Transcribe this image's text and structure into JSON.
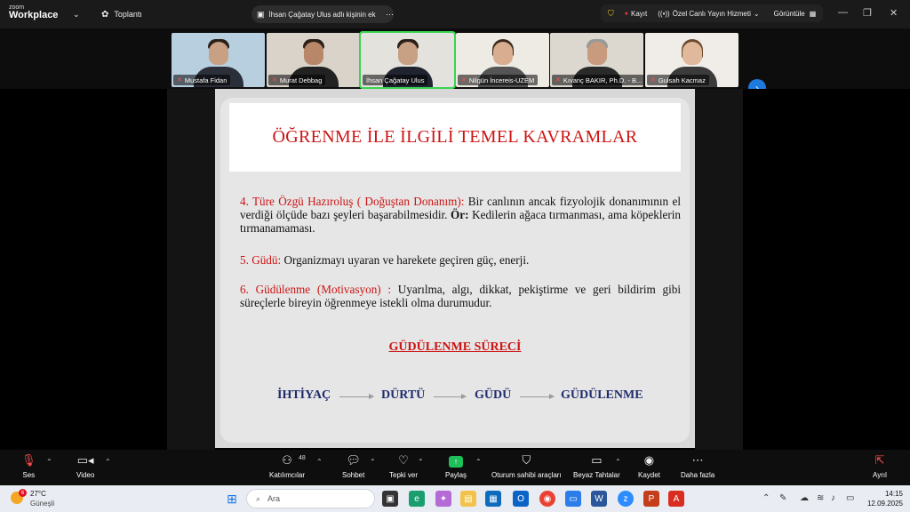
{
  "titlebar": {
    "logo_line1": "zoom",
    "logo_line2": "Workplace",
    "meeting_label": "Toplantı",
    "share_text": "İhsan Çağatay Ulus adlı kişinin ek",
    "record_label": "Kayıt",
    "live_label": "Özel Canlı Yayın Hizmeti",
    "view_label": "Görüntüle"
  },
  "participants": [
    {
      "name": "Mustafa Fidan"
    },
    {
      "name": "Murat Debbag"
    },
    {
      "name": "İhsan Çağatay Ulus"
    },
    {
      "name": "Nilgün İncereis-UZEM"
    },
    {
      "name": "Kıvanç BAKIR, Ph.D. - B..."
    },
    {
      "name": "Gulsah Kacmaz"
    }
  ],
  "slide": {
    "title": "ÖĞRENME İLE İLGİLİ TEMEL KAVRAMLAR",
    "p1_term": "4. Türe Özgü Hazıroluş ( Doğuştan Donanım):",
    "p1_text": " Bir canlının ancak fizyolojik donanımının el verdiği ölçüde bazı şeyleri başarabilmesidir. ",
    "p1_ex_label": "Ör:",
    "p1_ex_text": " Kedilerin ağaca tırmanması, ama köpeklerin tırmanamaması.",
    "p2_term": "5. Güdü:",
    "p2_text": " Organizmayı uyaran  ve harekete geçiren güç, enerji.",
    "p3_term": "6. Güdülenme (Motivasyon) :",
    "p3_text": " Uyarılma, algı, dikkat, pekiştirme ve geri bildirim gibi süreçlerle bireyin öğrenmeye istekli olma durumudur.",
    "process_title": "GÜDÜLENME SÜRECİ",
    "flow": [
      "İHTİYAÇ",
      "DÜRTÜ",
      "GÜDÜ",
      "GÜDÜLENME"
    ]
  },
  "toolbar": {
    "audio": "Ses",
    "video": "Video",
    "participants": "Katılımcılar",
    "participant_count": "48",
    "chat": "Sohbet",
    "react": "Tepki ver",
    "share": "Paylaş",
    "host_tools": "Oturum sahibi araçları",
    "whiteboard": "Beyaz Tahtalar",
    "record": "Kaydet",
    "more": "Daha fazla",
    "leave": "Ayrıl"
  },
  "taskbar": {
    "temperature": "27°C",
    "weather_desc": "Güneşli",
    "weather_badge": "6",
    "search_placeholder": "Ara",
    "time": "14:15",
    "date": "12.09.2025"
  }
}
